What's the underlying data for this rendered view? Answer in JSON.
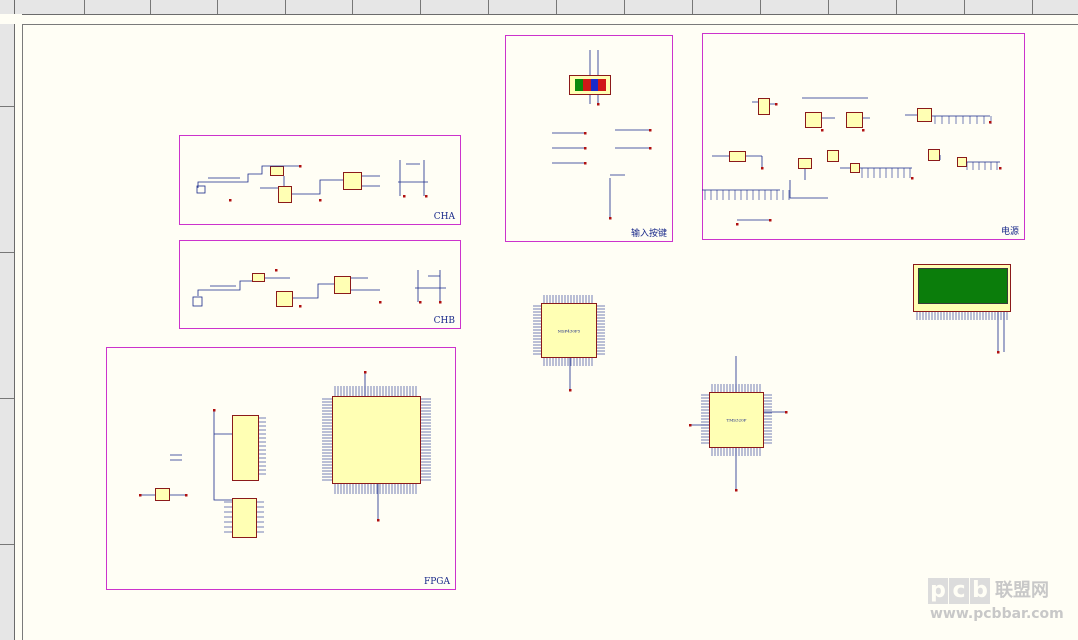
{
  "sheets": {
    "cha": {
      "label": "CHA"
    },
    "chb": {
      "label": "CHB"
    },
    "input_keys": {
      "label": "输入按键"
    },
    "power": {
      "label": "电源"
    },
    "fpga": {
      "label": "FPGA"
    }
  },
  "watermark": {
    "brand": "pcb",
    "cn": "联盟网",
    "url": "www.pcbbar.com"
  },
  "colors": {
    "sheet_background": "#fffef5",
    "sheet_border": "#cc33cc",
    "component_fill": "#ffffb4",
    "wire": "#1a2a8a",
    "lcd_screen": "#0b7d0b"
  }
}
